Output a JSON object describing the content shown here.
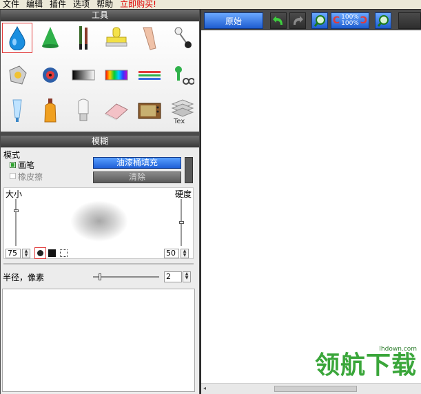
{
  "menu": {
    "items": [
      "文件",
      "编辑",
      "插件",
      "选项",
      "帮助"
    ],
    "buy": "立即购买!"
  },
  "tools_panel": {
    "title": "工具",
    "tools": [
      "blur-drop-tool-icon",
      "sharpen-cone-tool-icon",
      "paintbrush-tool-icon",
      "stamp-tool-icon",
      "smudge-finger-tool-icon",
      "pin-tool-icon",
      "lasso-gem-tool-icon",
      "red-eye-tool-icon",
      "grayscale-gradient-tool-icon",
      "rainbow-gradient-tool-icon",
      "color-lines-tool-icon",
      "pushpin-scissors-tool-icon",
      "tube-tool-icon",
      "bottle-tool-icon",
      "bulb-tool-icon",
      "eraser-tool-icon",
      "tv-tool-icon",
      "text-layers-tool-icon"
    ]
  },
  "blur_panel": {
    "title": "模糊",
    "mode_label": "模式",
    "brush_option": "画笔",
    "eraser_option": "橡皮擦",
    "fill_button": "油漆桶填充",
    "clear_button": "清除",
    "size_label": "大小",
    "hardness_label": "硬度",
    "size_value": "75",
    "hardness_value": "50",
    "radius_label": "半径，像素",
    "radius_value": "2",
    "size_level": 0.75,
    "hardness_level": 0.5,
    "radius_level": 0.1
  },
  "toolbar": {
    "original_button": "原始",
    "zoom_top": "100%",
    "zoom_bottom": "100%"
  },
  "watermark": {
    "text": "领航下载",
    "url": "lhdown.com"
  },
  "colors": {
    "accent_blue": "#1f5fd6",
    "panel_dark": "#4a4a4a",
    "buy_red": "#e00000",
    "watermark_green": "#3aa63a"
  }
}
